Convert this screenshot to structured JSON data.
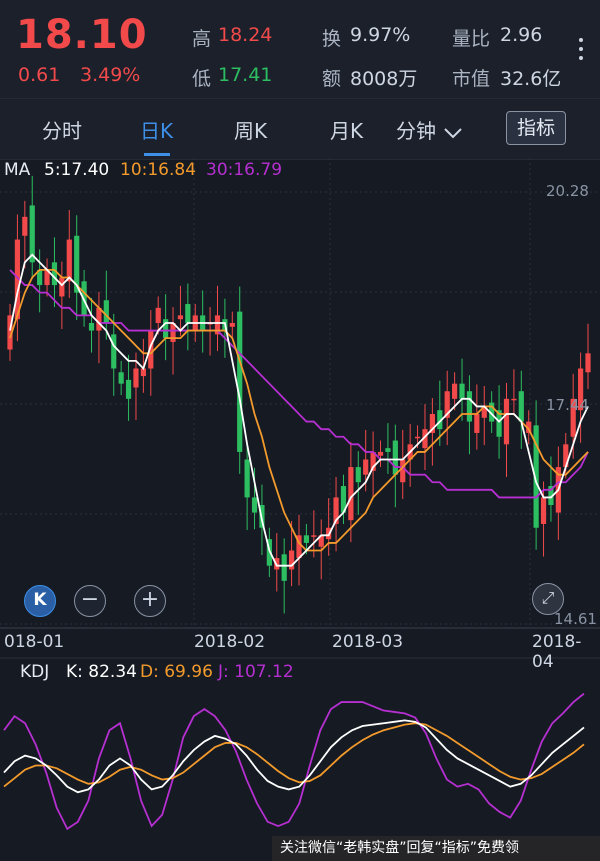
{
  "quote": {
    "price": "18.10",
    "change": "0.61",
    "change_pct": "3.49%",
    "high_label": "高",
    "high": "18.24",
    "low_label": "低",
    "low": "17.41",
    "turnover_label": "换",
    "turnover": "9.97%",
    "amount_label": "额",
    "amount": "8008万",
    "volume_ratio_label": "量比",
    "volume_ratio": "2.96",
    "market_cap_label": "市值",
    "market_cap": "32.6亿"
  },
  "tabs": {
    "items": [
      "分时",
      "日K",
      "周K",
      "月K",
      "分钟"
    ],
    "active": "日K",
    "indicator_button": "指标"
  },
  "ma_legend": {
    "prefix": "MA",
    "ma5": "5:17.40",
    "ma10": "10:16.84",
    "ma30": "30:16.79"
  },
  "price_axis": {
    "top": "20.28",
    "mid": "17.44",
    "bottom": "14.61"
  },
  "date_axis": [
    "018-01",
    "2018-02",
    "2018-03",
    "2018-04"
  ],
  "kdj_legend": {
    "prefix": "KDJ",
    "k": "K: 82.34",
    "d": "D: 69.96",
    "j": "J: 107.12"
  },
  "controls": {
    "k_button": "K",
    "zoom_out": "−",
    "zoom_in": "+"
  },
  "watermark": "关注微信“老韩实盘”回复“指标”免费领",
  "colors": {
    "up": "#f24a4a",
    "down": "#2dbe61",
    "ma5": "#ffffff",
    "ma10": "#f39a2c",
    "ma30": "#b62fd1",
    "accent": "#3d8fe8"
  },
  "chart_data": {
    "type": "candlestick",
    "ylim": [
      14.61,
      20.28
    ],
    "close": [
      18.6,
      19.6,
      19.9,
      19.3,
      19.0,
      19.2,
      19.0,
      19.1,
      19.6,
      18.9,
      18.6,
      18.4,
      18.7,
      18.5,
      17.9,
      17.7,
      17.5,
      17.9,
      17.9,
      18.4,
      18.7,
      18.3,
      18.5,
      18.6,
      18.5,
      18.6,
      18.4,
      18.5,
      18.6,
      18.4,
      18.5,
      16.8,
      16.2,
      16.0,
      15.8,
      15.3,
      15.4,
      15.1,
      15.5,
      15.7,
      15.6,
      15.7,
      15.7,
      15.8,
      16.2,
      16.0,
      16.6,
      16.4,
      16.7,
      16.8,
      16.8,
      16.8,
      16.5,
      16.7,
      16.9,
      17.0,
      17.1,
      17.3,
      17.1,
      17.6,
      17.7,
      17.5,
      17.2,
      17.3,
      17.4,
      17.2,
      17.0,
      17.5,
      17.5,
      17.2,
      17.2,
      15.8,
      16.2,
      16.1,
      16.6,
      16.9,
      17.5,
      17.9,
      18.1
    ],
    "ma5": [
      18.4,
      18.9,
      19.3,
      19.4,
      19.3,
      19.2,
      19.1,
      19.0,
      19.1,
      19.0,
      18.8,
      18.6,
      18.5,
      18.4,
      18.2,
      18.1,
      18.0,
      18.0,
      17.9,
      18.2,
      18.4,
      18.5,
      18.5,
      18.4,
      18.5,
      18.5,
      18.5,
      18.5,
      18.5,
      18.5,
      18.0,
      17.5,
      16.9,
      16.4,
      15.9,
      15.5,
      15.3,
      15.3,
      15.3,
      15.4,
      15.5,
      15.6,
      15.7,
      15.7,
      15.9,
      16.0,
      16.2,
      16.3,
      16.4,
      16.6,
      16.7,
      16.7,
      16.7,
      16.7,
      16.8,
      16.9,
      17.0,
      17.1,
      17.2,
      17.3,
      17.4,
      17.5,
      17.5,
      17.4,
      17.4,
      17.3,
      17.2,
      17.3,
      17.3,
      17.2,
      16.8,
      16.4,
      16.2,
      16.2,
      16.3,
      16.6,
      16.9,
      17.2,
      17.4
    ],
    "ma10": [
      18.3,
      18.6,
      18.9,
      19.1,
      19.2,
      19.2,
      19.2,
      19.1,
      19.1,
      19.0,
      18.9,
      18.8,
      18.7,
      18.6,
      18.5,
      18.4,
      18.3,
      18.2,
      18.1,
      18.1,
      18.2,
      18.3,
      18.3,
      18.3,
      18.4,
      18.4,
      18.4,
      18.4,
      18.4,
      18.4,
      18.3,
      18.0,
      17.7,
      17.3,
      17.0,
      16.6,
      16.3,
      16.0,
      15.8,
      15.6,
      15.5,
      15.5,
      15.5,
      15.6,
      15.6,
      15.7,
      15.8,
      15.9,
      16.0,
      16.2,
      16.3,
      16.4,
      16.5,
      16.6,
      16.7,
      16.8,
      16.8,
      16.9,
      17.0,
      17.1,
      17.2,
      17.3,
      17.3,
      17.3,
      17.4,
      17.4,
      17.3,
      17.3,
      17.3,
      17.2,
      17.1,
      16.9,
      16.7,
      16.6,
      16.5,
      16.5,
      16.6,
      16.7,
      16.8
    ],
    "ma30": [
      19.2,
      19.1,
      19.0,
      19.0,
      18.9,
      18.9,
      18.8,
      18.7,
      18.7,
      18.6,
      18.6,
      18.6,
      18.5,
      18.5,
      18.5,
      18.5,
      18.4,
      18.4,
      18.4,
      18.4,
      18.4,
      18.4,
      18.4,
      18.4,
      18.4,
      18.4,
      18.4,
      18.4,
      18.4,
      18.3,
      18.2,
      18.1,
      18.0,
      17.9,
      17.8,
      17.7,
      17.6,
      17.5,
      17.4,
      17.3,
      17.2,
      17.2,
      17.1,
      17.1,
      17.0,
      17.0,
      16.9,
      16.9,
      16.8,
      16.8,
      16.7,
      16.7,
      16.6,
      16.6,
      16.5,
      16.5,
      16.5,
      16.4,
      16.4,
      16.3,
      16.3,
      16.3,
      16.3,
      16.3,
      16.3,
      16.3,
      16.2,
      16.2,
      16.2,
      16.2,
      16.2,
      16.2,
      16.3,
      16.3,
      16.4,
      16.4,
      16.5,
      16.6,
      16.8
    ],
    "kdj": {
      "k": [
        50,
        58,
        62,
        60,
        55,
        48,
        40,
        36,
        38,
        45,
        55,
        60,
        55,
        45,
        38,
        40,
        48,
        58,
        66,
        72,
        76,
        74,
        70,
        62,
        52,
        44,
        40,
        38,
        40,
        48,
        58,
        68,
        75,
        80,
        83,
        84,
        85,
        86,
        87,
        86,
        82,
        74,
        66,
        60,
        56,
        52,
        48,
        44,
        40,
        42,
        48,
        56,
        64,
        70,
        76,
        82
      ],
      "d": [
        40,
        46,
        52,
        55,
        55,
        53,
        49,
        45,
        42,
        43,
        47,
        52,
        54,
        52,
        48,
        45,
        46,
        50,
        56,
        62,
        68,
        71,
        71,
        68,
        63,
        57,
        51,
        46,
        43,
        44,
        48,
        55,
        62,
        68,
        73,
        77,
        80,
        82,
        84,
        85,
        84,
        80,
        76,
        71,
        66,
        61,
        56,
        51,
        47,
        45,
        46,
        49,
        54,
        59,
        64,
        70
      ],
      "j": [
        80,
        90,
        85,
        70,
        50,
        25,
        10,
        15,
        30,
        60,
        80,
        85,
        60,
        30,
        12,
        20,
        45,
        75,
        90,
        95,
        90,
        80,
        65,
        45,
        28,
        15,
        12,
        15,
        28,
        55,
        80,
        95,
        100,
        100,
        100,
        97,
        94,
        93,
        92,
        89,
        78,
        60,
        45,
        40,
        42,
        38,
        28,
        22,
        18,
        30,
        52,
        72,
        85,
        92,
        100,
        106
      ]
    }
  }
}
